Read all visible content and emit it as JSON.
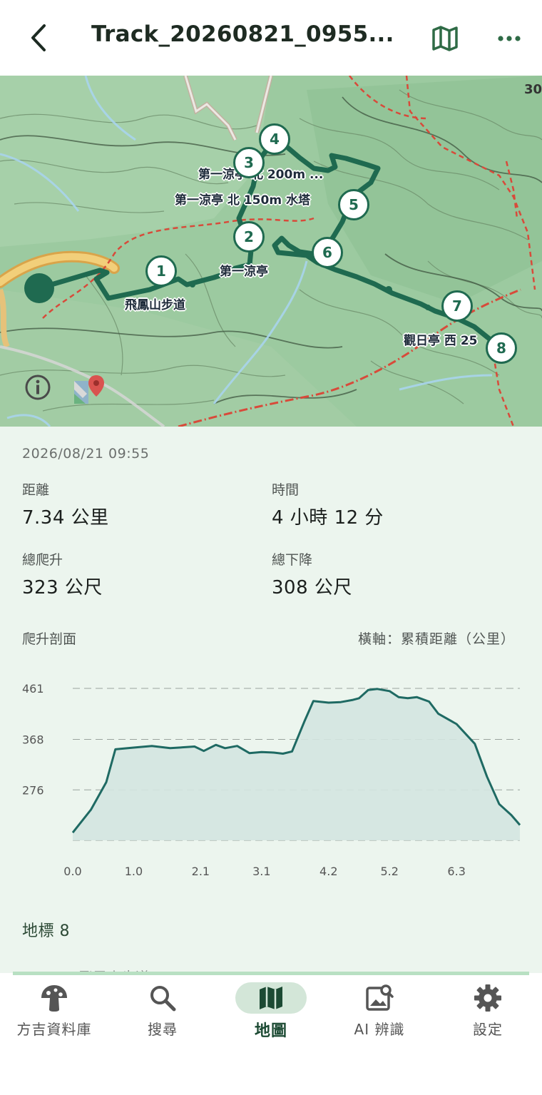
{
  "header": {
    "title": "Track_20260821_0955...",
    "back_icon": "chevron-left-icon",
    "map_icon": "map-icon",
    "more_icon": "more-horizontal-icon"
  },
  "map": {
    "labels": {
      "trail": "飛鳳山步道",
      "pavilion": "第一涼亭",
      "pavilion_north150": "第一涼亭 北 150m 水塔",
      "pavilion_north200": "第一涼亭 北 200m ...",
      "sunview": "觀日亭 西 25"
    },
    "scale_text": "30",
    "waypoints": [
      "1",
      "2",
      "3",
      "4",
      "5",
      "6",
      "7",
      "8"
    ],
    "route_color": "#1f6a50"
  },
  "track": {
    "datetime": "2026/08/21 09:55",
    "distance_label": "距離",
    "distance_value": "7.34 公里",
    "time_label": "時間",
    "time_value": "4 小時 12 分",
    "ascent_label": "總爬升",
    "ascent_value": "323 公尺",
    "descent_label": "總下降",
    "descent_value": "308 公尺"
  },
  "profile": {
    "title": "爬升剖面",
    "axis_note": "橫軸：累積距離（公里）"
  },
  "chart_data": {
    "type": "area",
    "title": "",
    "xlabel": "累積距離（公里）",
    "ylabel": "",
    "x_ticks": [
      "0.0",
      "1.0",
      "2.1",
      "3.1",
      "4.2",
      "5.2",
      "6.3"
    ],
    "y_ticks": [
      "461",
      "368",
      "276"
    ],
    "xlim": [
      0,
      7.34
    ],
    "ylim": [
      184,
      461
    ],
    "x": [
      0.0,
      0.3,
      0.55,
      0.7,
      1.0,
      1.3,
      1.6,
      2.0,
      2.15,
      2.35,
      2.5,
      2.7,
      2.9,
      3.1,
      3.3,
      3.45,
      3.6,
      3.8,
      3.95,
      4.2,
      4.4,
      4.6,
      4.7,
      4.85,
      5.0,
      5.2,
      5.35,
      5.5,
      5.65,
      5.85,
      6.0,
      6.3,
      6.6,
      6.8,
      7.0,
      7.2,
      7.34
    ],
    "y": [
      198,
      240,
      290,
      350,
      353,
      356,
      352,
      355,
      347,
      358,
      352,
      356,
      343,
      345,
      344,
      342,
      346,
      400,
      438,
      435,
      436,
      440,
      443,
      458,
      460,
      456,
      445,
      443,
      445,
      437,
      415,
      396,
      360,
      300,
      250,
      230,
      212
    ],
    "fill_color": "#d4e6e0",
    "line_color": "#1f6a63",
    "grid": true
  },
  "landmarks": {
    "title": "地標 8",
    "peek_text": "飛鳳山步道"
  },
  "tabs": [
    {
      "label": "方吉資料庫",
      "icon": "mushroom-icon",
      "active": false
    },
    {
      "label": "搜尋",
      "icon": "search-icon",
      "active": false
    },
    {
      "label": "地圖",
      "icon": "map-icon",
      "active": true
    },
    {
      "label": "AI 辨識",
      "icon": "image-search-icon",
      "active": false
    },
    {
      "label": "設定",
      "icon": "gear-icon",
      "active": false
    }
  ]
}
